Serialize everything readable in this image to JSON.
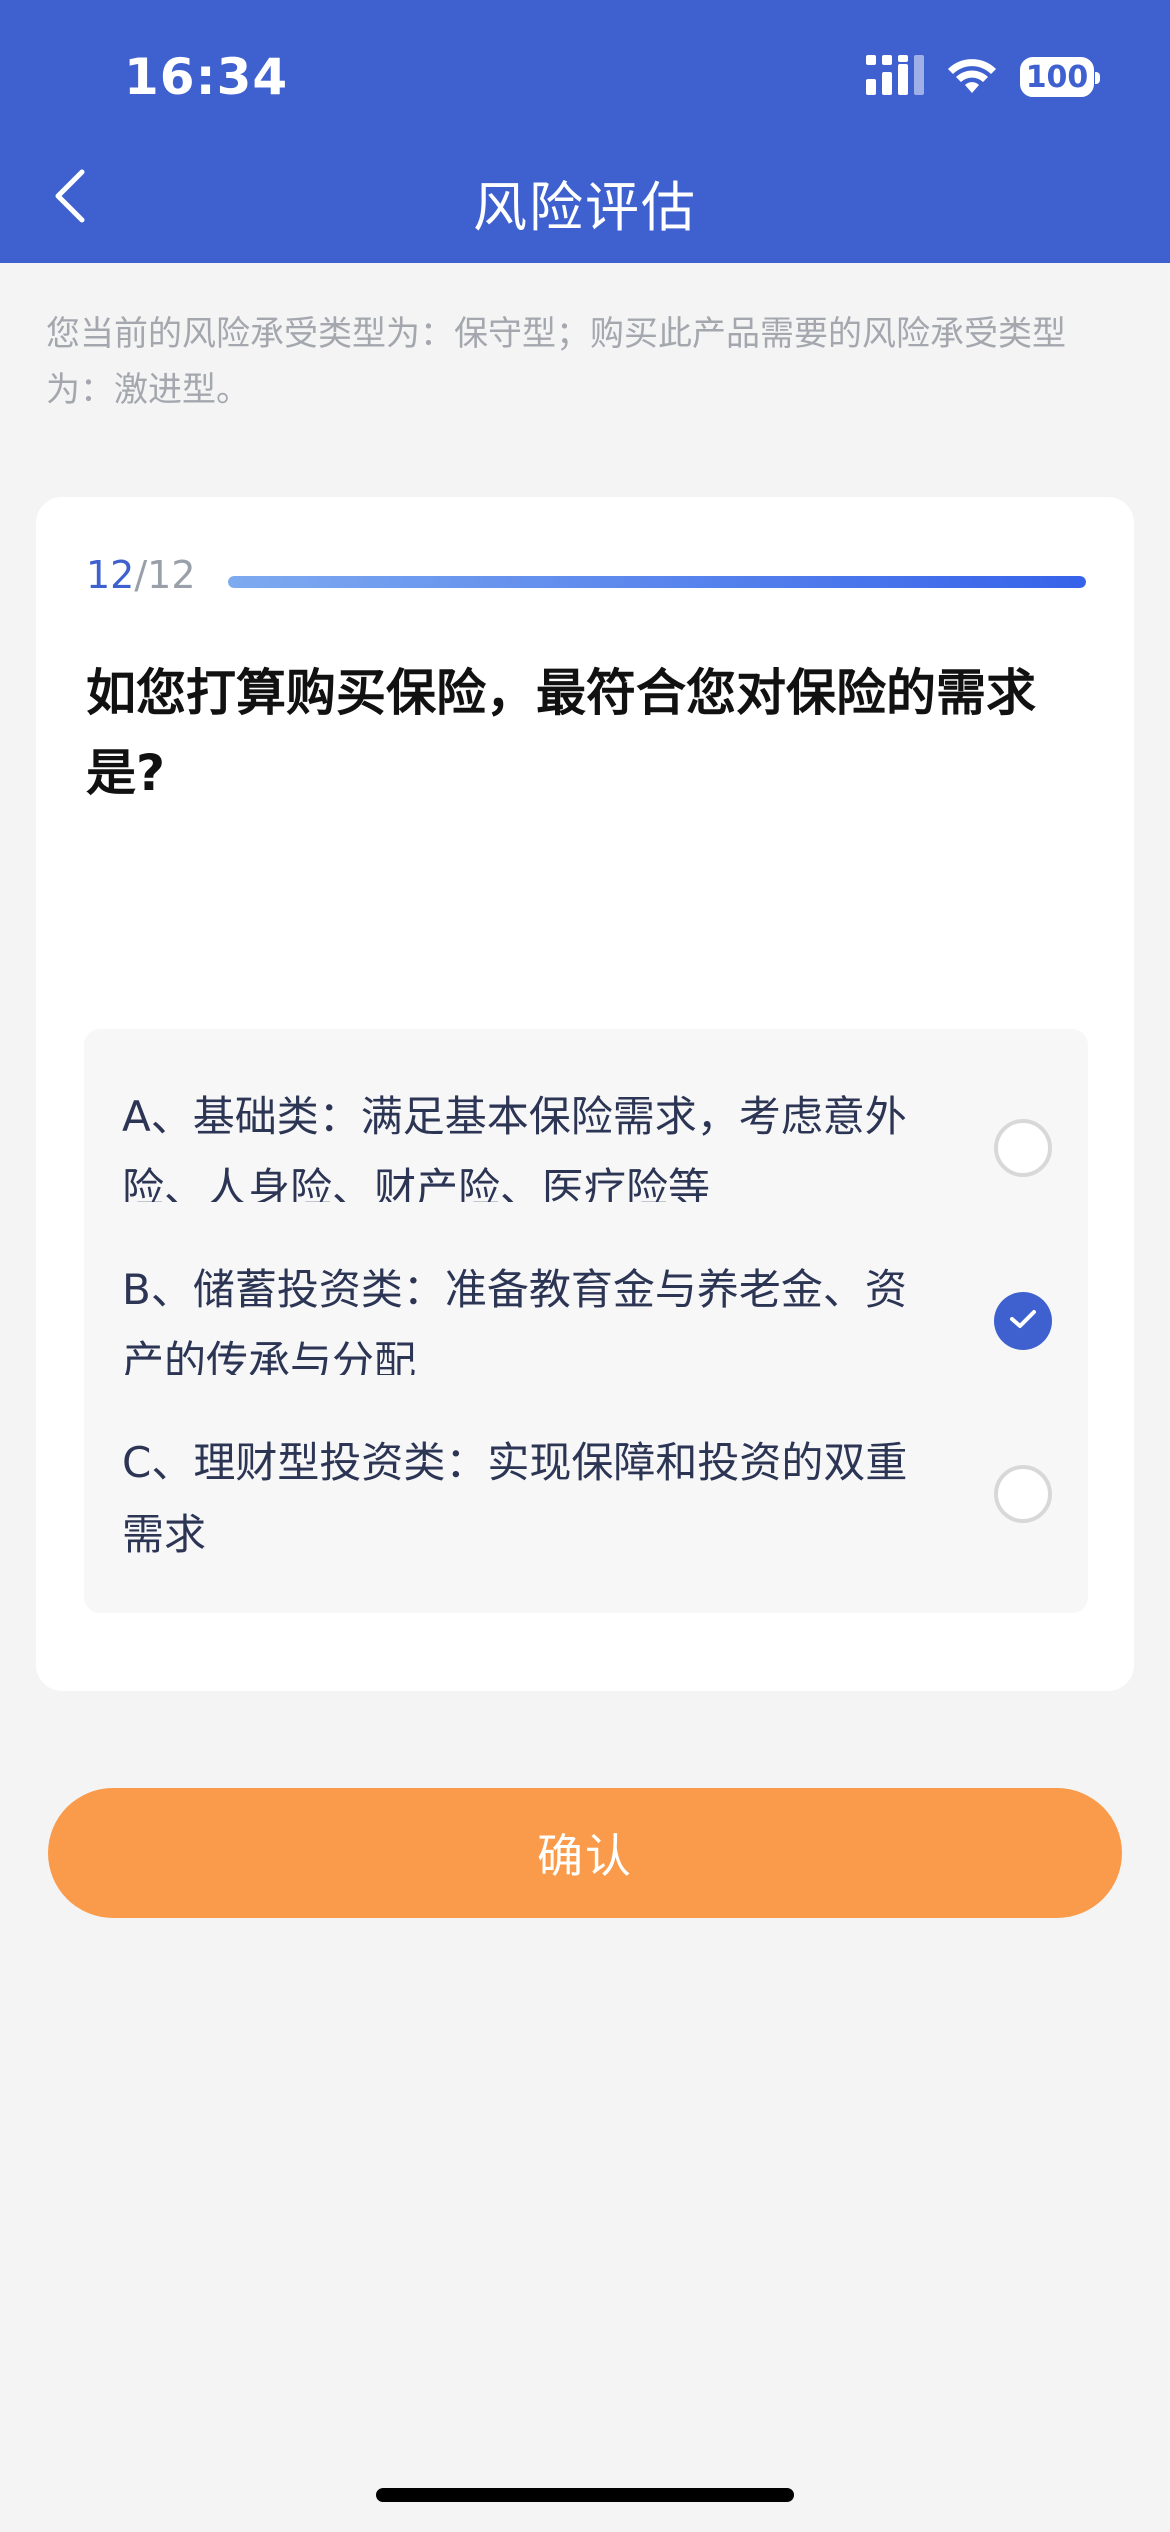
{
  "status_bar": {
    "time": "16:34",
    "battery": "100"
  },
  "nav": {
    "title": "风险评估"
  },
  "notice": "您当前的风险承受类型为：保守型；购买此产品需要的风险承受类型为：激进型。",
  "progress": {
    "current": "12",
    "separator": "/",
    "total": "12",
    "fraction": 1.0
  },
  "question": "如您打算购买保险，最符合您对保险的需求是?",
  "options": [
    {
      "label": "A、基础类：满足基本保险需求，考虑意外险、人身险、财产险、医疗险等",
      "selected": false
    },
    {
      "label": "B、储蓄投资类：准备教育金与养老金、资产的传承与分配",
      "selected": true
    },
    {
      "label": "C、理财型投资类：实现保障和投资的双重需求",
      "selected": false
    }
  ],
  "confirm_button": {
    "label": "确认"
  },
  "colors": {
    "header_bg": "#3f61d0",
    "accent": "#3f61d0",
    "button_bg": "#f99b4a",
    "page_bg": "#f4f4f4"
  },
  "icons": {
    "back": "chevron-left-icon",
    "signal": "cellular-signal-icon",
    "wifi": "wifi-icon",
    "battery": "battery-icon",
    "check": "checkmark-icon"
  }
}
